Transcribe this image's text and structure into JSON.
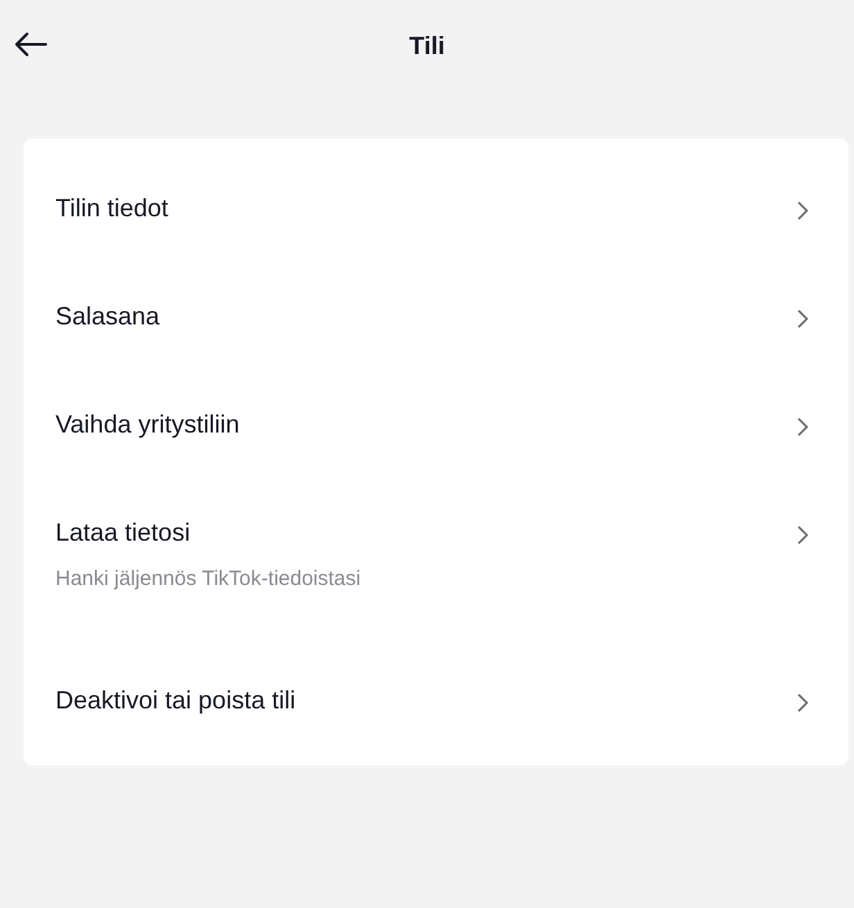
{
  "header": {
    "title": "Tili"
  },
  "items": [
    {
      "label": "Tilin tiedot"
    },
    {
      "label": "Salasana"
    },
    {
      "label": "Vaihda yritystiliin"
    },
    {
      "label": "Lataa tietosi",
      "description": "Hanki jäljennös TikTok-tiedoistasi"
    },
    {
      "label": "Deaktivoi tai poista tili"
    }
  ]
}
